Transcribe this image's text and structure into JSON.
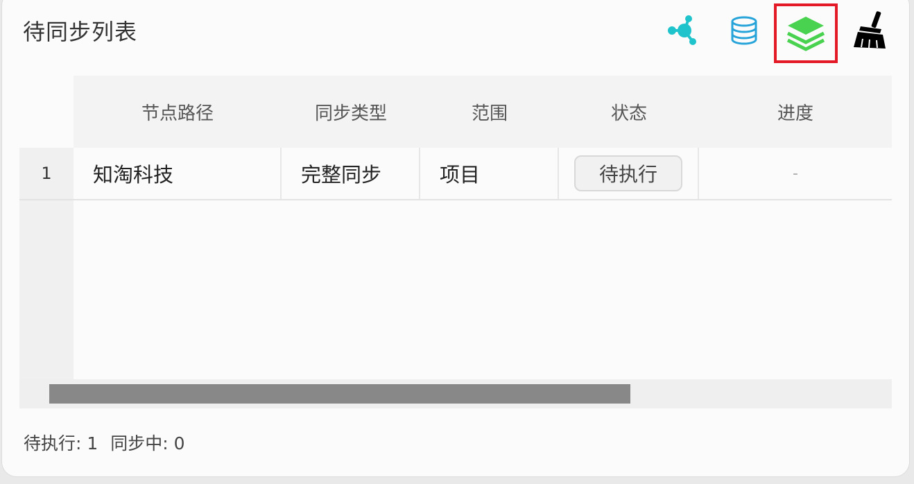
{
  "panel": {
    "title": "待同步列表"
  },
  "toolbar": {
    "icons": [
      {
        "name": "share-node-icon",
        "color": "#1fc3cc"
      },
      {
        "name": "database-icon",
        "color": "#26a3d9"
      },
      {
        "name": "layers-icon",
        "color": "#49d24f",
        "selected": true
      },
      {
        "name": "broom-icon",
        "color": "#000000"
      }
    ]
  },
  "table": {
    "columns": [
      "节点路径",
      "同步类型",
      "范围",
      "状态",
      "进度"
    ],
    "rows": [
      {
        "index": "1",
        "path": "知淘科技",
        "sync_type": "完整同步",
        "scope": "项目",
        "status": "待执行",
        "progress": "-"
      }
    ]
  },
  "footer": {
    "pending": "待执行: 1",
    "syncing": "同步中: 0"
  }
}
